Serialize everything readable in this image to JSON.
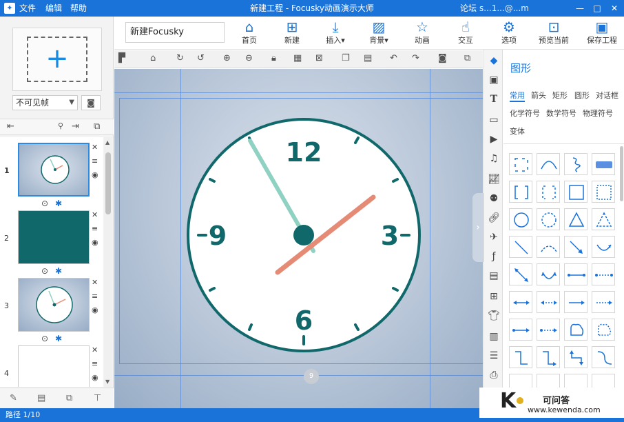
{
  "titlebar": {
    "menus": [
      "文件",
      "编辑",
      "帮助"
    ],
    "title": "新建工程 - Focusky动画演示大师",
    "forum": "论坛",
    "user": "s...1...@...m",
    "min": "—",
    "max": "□",
    "close": "✕"
  },
  "left": {
    "frame_type": "不可见帧",
    "slides": [
      {
        "num": "1"
      },
      {
        "num": "2"
      },
      {
        "num": "3"
      },
      {
        "num": "4"
      }
    ]
  },
  "toolbar": {
    "project_name": "新建Focusky",
    "buttons": [
      {
        "label": "首页",
        "icon": "home-icon"
      },
      {
        "label": "新建",
        "icon": "new-frame-icon"
      },
      {
        "label": "插入▾",
        "icon": "insert-icon"
      },
      {
        "label": "背景▾",
        "icon": "background-icon"
      },
      {
        "label": "动画",
        "icon": "animation-star-icon"
      },
      {
        "label": "交互",
        "icon": "interact-hand-icon"
      },
      {
        "label": "选项",
        "icon": "gear-icon"
      },
      {
        "label": "预览当前",
        "icon": "preview-icon"
      },
      {
        "label": "保存工程",
        "icon": "save-icon"
      }
    ]
  },
  "canvas": {
    "clock_numbers": [
      "12",
      "3",
      "6",
      "9"
    ],
    "page_badge": "9",
    "colors": {
      "teal": "#11686a",
      "minute_hand": "#8fd1c2",
      "hour_hand": "#e58a74"
    }
  },
  "shapes_panel": {
    "title": "图形",
    "categories_row1": [
      "常用",
      "箭头",
      "矩形",
      "圆形",
      "对话框"
    ],
    "categories_row2": [
      "化学符号",
      "数学符号",
      "物理符号"
    ],
    "categories_row3": [
      "变体"
    ]
  },
  "status": {
    "path": "路径 1/10"
  },
  "watermark": {
    "logo": "K",
    "line1": "可问答",
    "line2": "www.kewenda.com"
  }
}
